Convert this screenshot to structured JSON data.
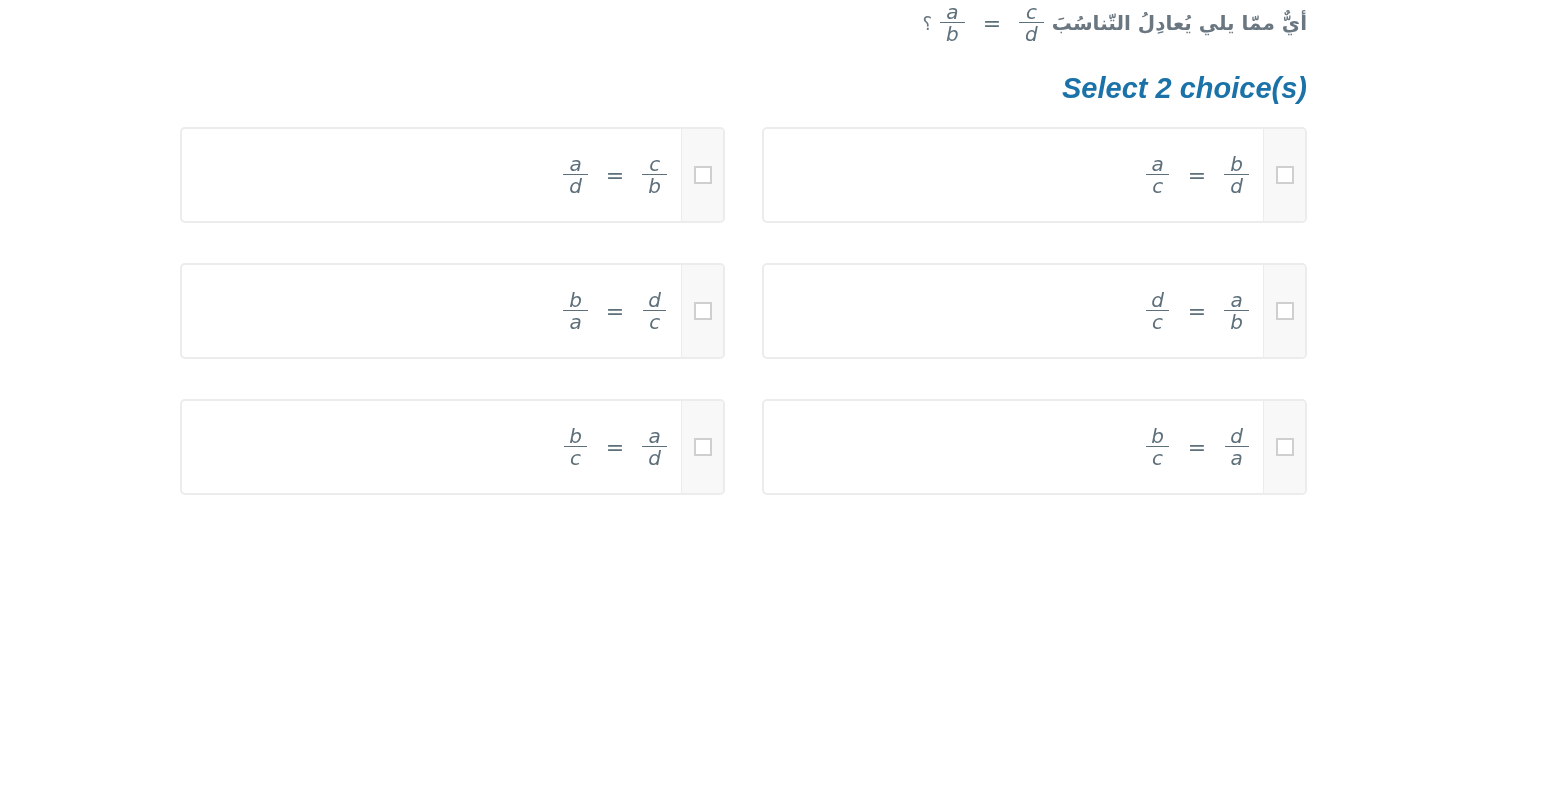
{
  "question": {
    "text": "أيٌّ ممّا يلي يُعادِلُ التّناسُبَ",
    "equation": {
      "left": {
        "num": "a",
        "den": "b"
      },
      "sign": "=",
      "right": {
        "num": "c",
        "den": "d"
      }
    },
    "mark": "؟"
  },
  "instruction": "Select 2 choice(s)",
  "choices": [
    {
      "left": {
        "num": "a",
        "den": "c"
      },
      "sign": "=",
      "right": {
        "num": "b",
        "den": "d"
      },
      "checked": false
    },
    {
      "left": {
        "num": "a",
        "den": "d"
      },
      "sign": "=",
      "right": {
        "num": "c",
        "den": "b"
      },
      "checked": false
    },
    {
      "left": {
        "num": "d",
        "den": "c"
      },
      "sign": "=",
      "right": {
        "num": "a",
        "den": "b"
      },
      "checked": false
    },
    {
      "left": {
        "num": "b",
        "den": "a"
      },
      "sign": "=",
      "right": {
        "num": "d",
        "den": "c"
      },
      "checked": false
    },
    {
      "left": {
        "num": "b",
        "den": "c"
      },
      "sign": "=",
      "right": {
        "num": "d",
        "den": "a"
      },
      "checked": false
    },
    {
      "left": {
        "num": "b",
        "den": "c"
      },
      "sign": "=",
      "right": {
        "num": "a",
        "den": "d"
      },
      "checked": false
    }
  ]
}
